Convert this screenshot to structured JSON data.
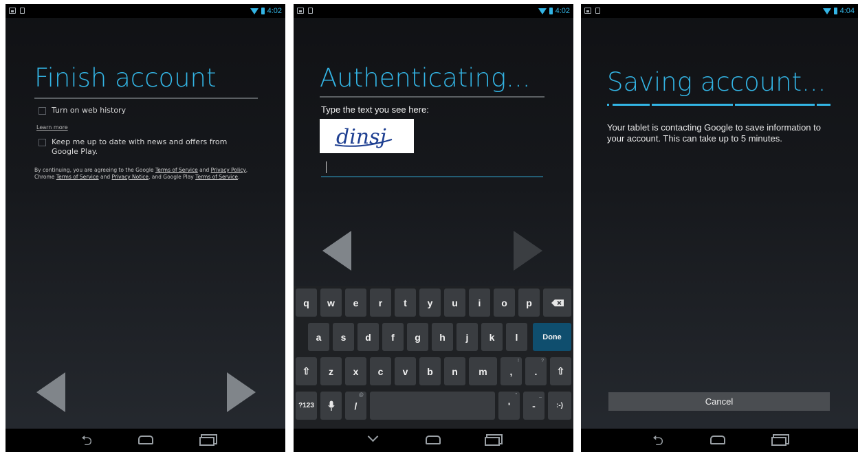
{
  "status": {
    "time_1": "4:02",
    "time_2": "4:02",
    "time_3": "4:04"
  },
  "screen1": {
    "title": "Finish account",
    "web_history_label": "Turn on web history",
    "learn_more": "Learn more",
    "news_label": "Keep me up to date with news and offers from Google Play.",
    "legal": {
      "t1": "By continuing, you are agreeing to the Google ",
      "tos1": "Terms of Service",
      "t2": " and ",
      "privacy_policy": "Privacy Policy",
      "t3": ", Chrome ",
      "tos2": "Terms of Service",
      "t4": " and ",
      "privacy_notice": "Privacy Notice",
      "t5": ", and Google Play ",
      "tos3": "Terms of Service",
      "t6": "."
    }
  },
  "screen2": {
    "title": "Authenticating...",
    "prompt": "Type the text you see here:",
    "captcha_text": "dinsj",
    "keyboard": {
      "row1": [
        "q",
        "w",
        "e",
        "r",
        "t",
        "y",
        "u",
        "i",
        "o",
        "p"
      ],
      "row2": [
        "a",
        "s",
        "d",
        "f",
        "g",
        "h",
        "j",
        "k",
        "l"
      ],
      "done": "Done",
      "row3": [
        "z",
        "x",
        "c",
        "v",
        "b",
        "n",
        "m",
        ",",
        "."
      ],
      "row3_hints": [
        "",
        "",
        "",
        "",
        "",
        "",
        "",
        "!",
        "?"
      ],
      "symbols": "?123",
      "slash": "/",
      "slash_hint": "@",
      "apostrophe": "'",
      "apostrophe_hint": "\"",
      "dash": "-",
      "dash_hint": "_",
      "smiley": ":-)"
    }
  },
  "screen3": {
    "title": "Saving account...",
    "message": "Your tablet is contacting Google to save information to your account. This can take up to 5 minutes.",
    "cancel": "Cancel"
  },
  "icons": {
    "back": "back-arrow-icon",
    "home": "home-icon",
    "recents": "recent-apps-icon",
    "backspace": "backspace-icon",
    "shift": "shift-icon",
    "mic": "microphone-icon"
  },
  "colors": {
    "accent": "#33b5e5",
    "background": "#16181c",
    "done_key": "#0f4e6e"
  }
}
